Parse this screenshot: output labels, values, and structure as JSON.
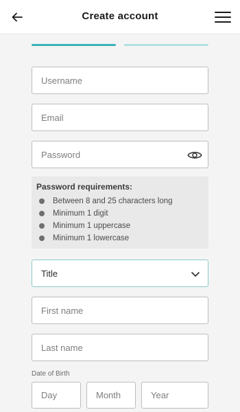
{
  "header": {
    "title": "Create account",
    "back_icon": "arrow-left-icon",
    "menu_icon": "hamburger-menu-icon"
  },
  "progress": {
    "total_steps": 2,
    "current_step": 1,
    "active_color": "#3bb3b6",
    "inactive_color": "#b3e1e3"
  },
  "form": {
    "username": {
      "placeholder": "Username",
      "value": ""
    },
    "email": {
      "placeholder": "Email",
      "value": ""
    },
    "password": {
      "placeholder": "Password",
      "value": "",
      "toggle_icon": "eye-icon"
    },
    "requirements": {
      "title": "Password requirements:",
      "items": [
        "Between 8 and 25 characters long",
        "Minimum 1 digit",
        "Minimum 1 uppercase",
        "Minimum 1 lowercase"
      ]
    },
    "title_select": {
      "selected": "Title",
      "icon": "chevron-down-icon"
    },
    "first_name": {
      "placeholder": "First name",
      "value": ""
    },
    "last_name": {
      "placeholder": "Last name",
      "value": ""
    },
    "dob": {
      "label": "Date of Birth",
      "day_placeholder": "Day",
      "month_placeholder": "Month",
      "year_placeholder": "Year"
    }
  }
}
